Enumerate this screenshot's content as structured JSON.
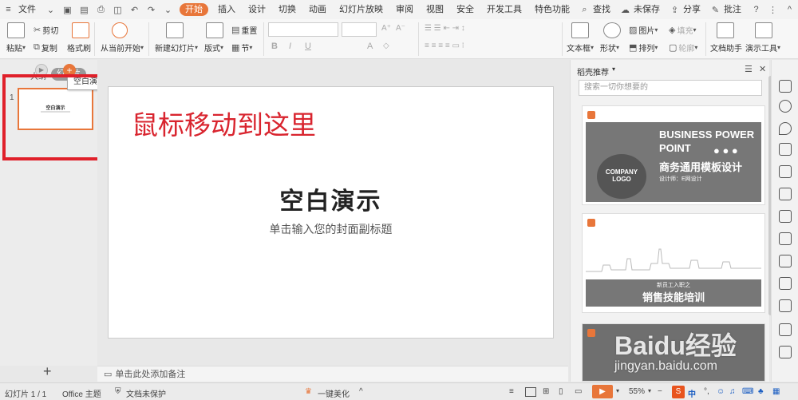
{
  "menubar": {
    "file_label": "文件",
    "tabs": [
      "开始",
      "插入",
      "设计",
      "切换",
      "动画",
      "幻灯片放映",
      "审阅",
      "视图",
      "安全",
      "开发工具",
      "特色功能"
    ],
    "search_label": "查找",
    "unsaved_label": "未保存",
    "share_label": "分享",
    "comment_label": "批注"
  },
  "ribbon": {
    "paste": "粘贴",
    "cut": "剪切",
    "copy": "复制",
    "format_painter": "格式刷",
    "from_current": "从当前开始",
    "new_slide": "新建幻灯片",
    "layout": "版式",
    "reset": "重置",
    "section": "节",
    "bold": "B",
    "italic": "I",
    "underline": "U",
    "textbox": "文本框",
    "shape": "形状",
    "picture": "图片",
    "fill": "填充",
    "arrange": "排列",
    "outline": "轮廓",
    "doc_assistant": "文档助手",
    "presentation_tools": "演示工具"
  },
  "leftpane": {
    "tab_outline": "大纲",
    "tab_slides": "幻灯片",
    "slide_number": "1",
    "thumb_title": "空白演示",
    "tooltip": "空白演示",
    "add_slide": "+"
  },
  "slide": {
    "title": "空白演示",
    "subtitle": "单击输入您的封面副标题"
  },
  "annotation": "鼠标移动到这里",
  "notes": "单击此处添加备注",
  "rightpane": {
    "title": "稻壳推荐",
    "search_placeholder": "搜索一切你想要的",
    "card1": {
      "line1": "BUSINESS POWER",
      "line2": "POINT",
      "logo1": "COMPANY",
      "logo2": "LOGO",
      "cn_title": "商务通用模板设计",
      "designer": "设计师：E网设计"
    },
    "card2": {
      "small": "新员工入职之",
      "title": "销售技能培训"
    }
  },
  "statusbar": {
    "slide_info": "幻灯片 1 / 1",
    "theme": "Office 主题",
    "protect": "文档未保护",
    "beautify": "一键美化",
    "zoom": "55%",
    "ime": "中"
  },
  "watermark": {
    "brand": "Baidu经验",
    "url": "jingyan.baidu.com"
  },
  "colors": {
    "accent": "#e8763a",
    "highlight_red": "#e0202a",
    "annotation_red": "#d9252f"
  }
}
